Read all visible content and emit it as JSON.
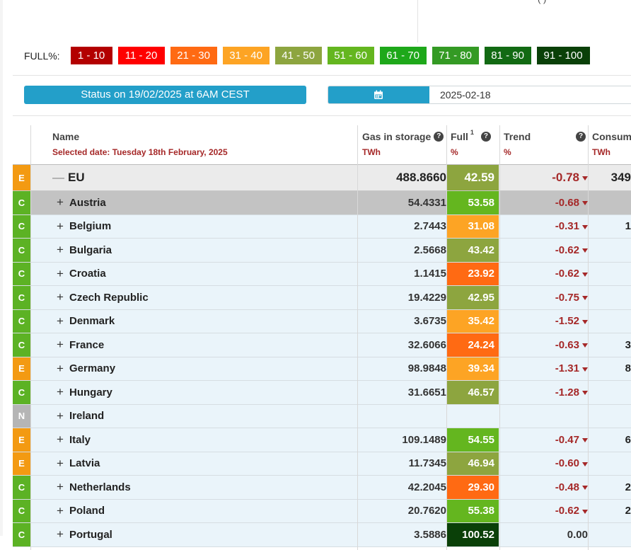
{
  "top_fragment": "(  )",
  "legend": {
    "label": "FULL%:",
    "chips": [
      {
        "label": "1 - 10",
        "color": "#b30000",
        "w": 59
      },
      {
        "label": "11 - 20",
        "color": "#ff0000",
        "w": 66
      },
      {
        "label": "21 - 30",
        "color": "#ff6a13",
        "w": 66
      },
      {
        "label": "31 - 40",
        "color": "#fda424",
        "w": 66
      },
      {
        "label": "41 - 50",
        "color": "#8da53f",
        "w": 66
      },
      {
        "label": "51 - 60",
        "color": "#64b61f",
        "w": 66
      },
      {
        "label": "61 - 70",
        "color": "#1ea81a",
        "w": 66
      },
      {
        "label": "71 - 80",
        "color": "#349a24",
        "w": 66
      },
      {
        "label": "81 - 90",
        "color": "#126a13",
        "w": 66
      },
      {
        "label": "91 - 100",
        "color": "#0a4008",
        "w": 75
      }
    ]
  },
  "status_label": "Status on 19/02/2025 at 6AM CEST",
  "date_value": "2025-02-18",
  "headers": {
    "name": "Name",
    "selected_date": "Selected date: Tuesday 18th February, 2025",
    "gas": "Gas in storage",
    "gas_unit": "TWh",
    "full": "Full",
    "full_sup": "1",
    "full_unit": "%",
    "trend": "Trend",
    "trend_unit": "%",
    "consumption": "Consum",
    "consumption_unit": "TWh"
  },
  "badge_colors": {
    "E": "#f39a12",
    "C": "#5cb224",
    "N": "#b5b5b5"
  },
  "rows": [
    {
      "badge": "E",
      "toggle": "—",
      "name": "EU",
      "gas": "488.8660",
      "full": "42.59",
      "full_color": "#8da53f",
      "trend": "-0.78",
      "cons": "349",
      "eu": true
    },
    {
      "badge": "C",
      "toggle": "+",
      "name": "Austria",
      "gas": "54.4331",
      "full": "53.58",
      "full_color": "#64b61f",
      "trend": "-0.68",
      "cons": "",
      "sel": true
    },
    {
      "badge": "C",
      "toggle": "+",
      "name": "Belgium",
      "gas": "2.7443",
      "full": "31.08",
      "full_color": "#fda424",
      "trend": "-0.31",
      "cons": "1"
    },
    {
      "badge": "C",
      "toggle": "+",
      "name": "Bulgaria",
      "gas": "2.5668",
      "full": "43.42",
      "full_color": "#8da53f",
      "trend": "-0.62",
      "cons": ""
    },
    {
      "badge": "C",
      "toggle": "+",
      "name": "Croatia",
      "gas": "1.1415",
      "full": "23.92",
      "full_color": "#ff6a13",
      "trend": "-0.62",
      "cons": ""
    },
    {
      "badge": "C",
      "toggle": "+",
      "name": "Czech Republic",
      "gas": "19.4229",
      "full": "42.95",
      "full_color": "#8da53f",
      "trend": "-0.75",
      "cons": ""
    },
    {
      "badge": "C",
      "toggle": "+",
      "name": "Denmark",
      "gas": "3.6735",
      "full": "35.42",
      "full_color": "#fda424",
      "trend": "-1.52",
      "cons": ""
    },
    {
      "badge": "C",
      "toggle": "+",
      "name": "France",
      "gas": "32.6066",
      "full": "24.24",
      "full_color": "#ff6a13",
      "trend": "-0.63",
      "cons": "3"
    },
    {
      "badge": "E",
      "toggle": "+",
      "name": "Germany",
      "gas": "98.9848",
      "full": "39.34",
      "full_color": "#fda424",
      "trend": "-1.31",
      "cons": "8"
    },
    {
      "badge": "C",
      "toggle": "+",
      "name": "Hungary",
      "gas": "31.6651",
      "full": "46.57",
      "full_color": "#8da53f",
      "trend": "-1.28",
      "cons": ""
    },
    {
      "badge": "N",
      "toggle": "+",
      "name": "Ireland",
      "gas": "",
      "full": "",
      "full_color": "",
      "trend": "",
      "cons": ""
    },
    {
      "badge": "E",
      "toggle": "+",
      "name": "Italy",
      "gas": "109.1489",
      "full": "54.55",
      "full_color": "#64b61f",
      "trend": "-0.47",
      "cons": "6"
    },
    {
      "badge": "E",
      "toggle": "+",
      "name": "Latvia",
      "gas": "11.7345",
      "full": "46.94",
      "full_color": "#8da53f",
      "trend": "-0.60",
      "cons": ""
    },
    {
      "badge": "C",
      "toggle": "+",
      "name": "Netherlands",
      "gas": "42.2045",
      "full": "29.30",
      "full_color": "#ff6a13",
      "trend": "-0.48",
      "cons": "2"
    },
    {
      "badge": "C",
      "toggle": "+",
      "name": "Poland",
      "gas": "20.7620",
      "full": "55.38",
      "full_color": "#64b61f",
      "trend": "-0.62",
      "cons": "2"
    },
    {
      "badge": "C",
      "toggle": "+",
      "name": "Portugal",
      "gas": "3.5886",
      "full": "100.52",
      "full_color": "#0a4008",
      "trend": "0.00",
      "cons": ""
    }
  ]
}
